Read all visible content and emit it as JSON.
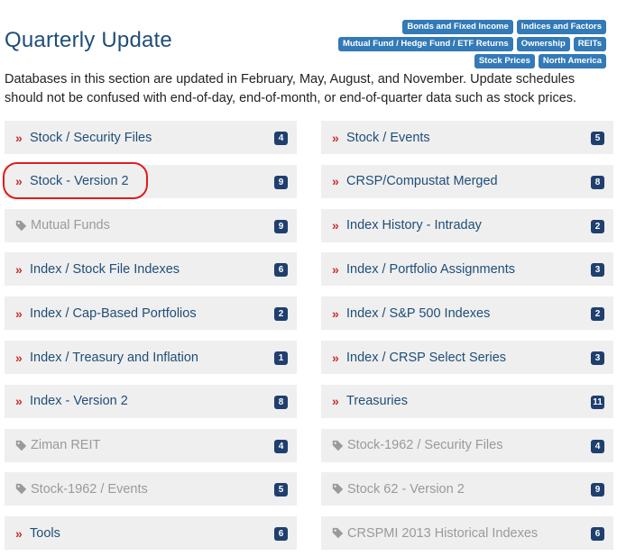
{
  "header": {
    "title": "Quarterly Update",
    "tags_row1": [
      "Bonds and Fixed Income",
      "Indices and Factors"
    ],
    "tags_row2": [
      "Mutual Fund / Hedge Fund / ETF Returns",
      "Ownership",
      "REITs"
    ],
    "tags_row3": [
      "Stock Prices",
      "North America"
    ]
  },
  "description": "Databases in this section are updated in February, May, August, and November. Update schedules should not be confused with end-of-day, end-of-month, or end-of-quarter data such as stock prices.",
  "items": [
    {
      "label": "Stock / Security Files",
      "count": "4",
      "enabled": true
    },
    {
      "label": "Stock / Events",
      "count": "5",
      "enabled": true
    },
    {
      "label": "Stock - Version 2",
      "count": "9",
      "enabled": true
    },
    {
      "label": "CRSP/Compustat Merged",
      "count": "8",
      "enabled": true
    },
    {
      "label": "Mutual Funds",
      "count": "9",
      "enabled": false
    },
    {
      "label": "Index History - Intraday",
      "count": "2",
      "enabled": true
    },
    {
      "label": "Index / Stock File Indexes",
      "count": "6",
      "enabled": true
    },
    {
      "label": "Index / Portfolio Assignments",
      "count": "3",
      "enabled": true
    },
    {
      "label": "Index / Cap-Based Portfolios",
      "count": "2",
      "enabled": true
    },
    {
      "label": "Index / S&P 500 Indexes",
      "count": "2",
      "enabled": true
    },
    {
      "label": "Index / Treasury and Inflation",
      "count": "1",
      "enabled": true
    },
    {
      "label": "Index / CRSP Select Series",
      "count": "3",
      "enabled": true
    },
    {
      "label": "Index - Version 2",
      "count": "8",
      "enabled": true
    },
    {
      "label": "Treasuries",
      "count": "11",
      "enabled": true
    },
    {
      "label": "Ziman REIT",
      "count": "4",
      "enabled": false
    },
    {
      "label": "Stock-1962 / Security Files",
      "count": "4",
      "enabled": false
    },
    {
      "label": "Stock-1962 / Events",
      "count": "5",
      "enabled": false
    },
    {
      "label": "Stock 62 - Version 2",
      "count": "9",
      "enabled": false
    },
    {
      "label": "Tools",
      "count": "6",
      "enabled": true
    },
    {
      "label": "CRSPMI 2013 Historical Indexes",
      "count": "6",
      "enabled": false
    }
  ],
  "colors": {
    "accent_red": "#c9302c",
    "link_blue": "#1f4e79",
    "badge_navy": "#1f3f6e",
    "tag_blue": "#337ab7",
    "disabled_gray": "#9a9a9a",
    "highlight_circle": "#e21b1b"
  },
  "icons": {
    "enabled_item": "double-chevron-right-icon",
    "disabled_item": "tag-icon"
  }
}
